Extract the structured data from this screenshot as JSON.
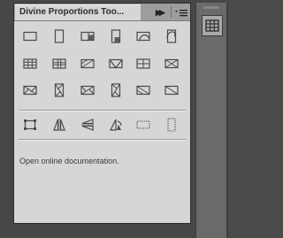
{
  "panel": {
    "title": "Divine Proportions Too...",
    "expand_glyph": "▶▶",
    "menu_icon": "panel-menu-icon",
    "doc_link": "Open online documentation."
  },
  "colors": {
    "icon_stroke": "#4a4a4a",
    "panel_bg": "#d6d6d6",
    "titlebar_bg": "#9d9d9d",
    "dock_bg": "#6a6a6a"
  },
  "icons": [
    {
      "name": "landscape-frame-icon",
      "glyph": "landscape"
    },
    {
      "name": "portrait-frame-icon",
      "glyph": "portrait"
    },
    {
      "name": "golden-rect-landscape-icon",
      "glyph": "gr-land"
    },
    {
      "name": "golden-rect-portrait-icon",
      "glyph": "gr-port"
    },
    {
      "name": "golden-spiral-landscape-icon",
      "glyph": "spiral-land"
    },
    {
      "name": "golden-spiral-portrait-icon",
      "glyph": "spiral-port"
    },
    {
      "name": "thirds-grid-icon",
      "glyph": "grid3"
    },
    {
      "name": "phi-grid-icon",
      "glyph": "grid3b"
    },
    {
      "name": "diagonal-landscape-icon",
      "glyph": "diag-land"
    },
    {
      "name": "triangle-landscape-icon",
      "glyph": "tri-land"
    },
    {
      "name": "quadrant-icon",
      "glyph": "quad"
    },
    {
      "name": "x-diagonal-icon",
      "glyph": "xdiag"
    },
    {
      "name": "harmonic-landscape-icon",
      "glyph": "harm-land"
    },
    {
      "name": "harmonic-portrait-icon",
      "glyph": "harm-port"
    },
    {
      "name": "golden-triangle-landscape-icon",
      "glyph": "gt-land"
    },
    {
      "name": "golden-triangle-portrait-icon",
      "glyph": "gt-port"
    },
    {
      "name": "baroque-diagonal-icon",
      "glyph": "baroque"
    },
    {
      "name": "sinister-diagonal-icon",
      "glyph": "sinister"
    },
    {
      "name": "crop-corners-icon",
      "glyph": "crop"
    },
    {
      "name": "flip-horizontal-icon",
      "glyph": "fliph"
    },
    {
      "name": "flip-vertical-icon",
      "glyph": "flipv"
    },
    {
      "name": "rotate-icon",
      "glyph": "rotate"
    },
    {
      "name": "dotted-landscape-icon",
      "glyph": "dot-land"
    },
    {
      "name": "dotted-portrait-icon",
      "glyph": "dot-port"
    }
  ],
  "dock": {
    "button_icon": "grid-panel-icon"
  }
}
